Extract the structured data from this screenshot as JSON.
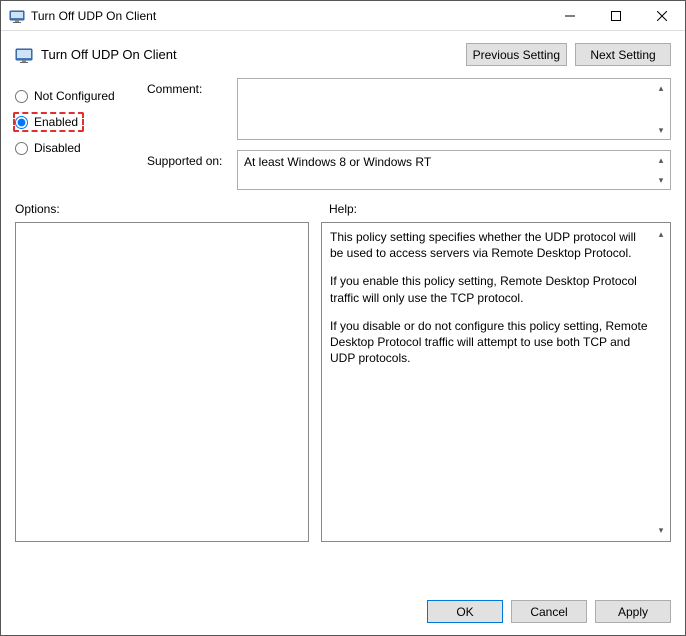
{
  "window": {
    "title": "Turn Off UDP On Client"
  },
  "header": {
    "title": "Turn Off UDP On Client",
    "prev_label": "Previous Setting",
    "next_label": "Next Setting"
  },
  "radios": {
    "not_configured": "Not Configured",
    "enabled": "Enabled",
    "disabled": "Disabled",
    "selected": "enabled"
  },
  "fields": {
    "comment_label": "Comment:",
    "comment_value": "",
    "supported_label": "Supported on:",
    "supported_value": "At least Windows 8 or Windows RT"
  },
  "labels": {
    "options": "Options:",
    "help": "Help:"
  },
  "help": {
    "p1": "This policy setting specifies whether the UDP protocol will be used to access servers via Remote Desktop Protocol.",
    "p2": "If you enable this policy setting, Remote Desktop Protocol traffic will only use the TCP protocol.",
    "p3": "If you disable or do not configure this policy setting, Remote Desktop Protocol traffic will attempt to use both TCP and UDP protocols."
  },
  "footer": {
    "ok": "OK",
    "cancel": "Cancel",
    "apply": "Apply"
  }
}
